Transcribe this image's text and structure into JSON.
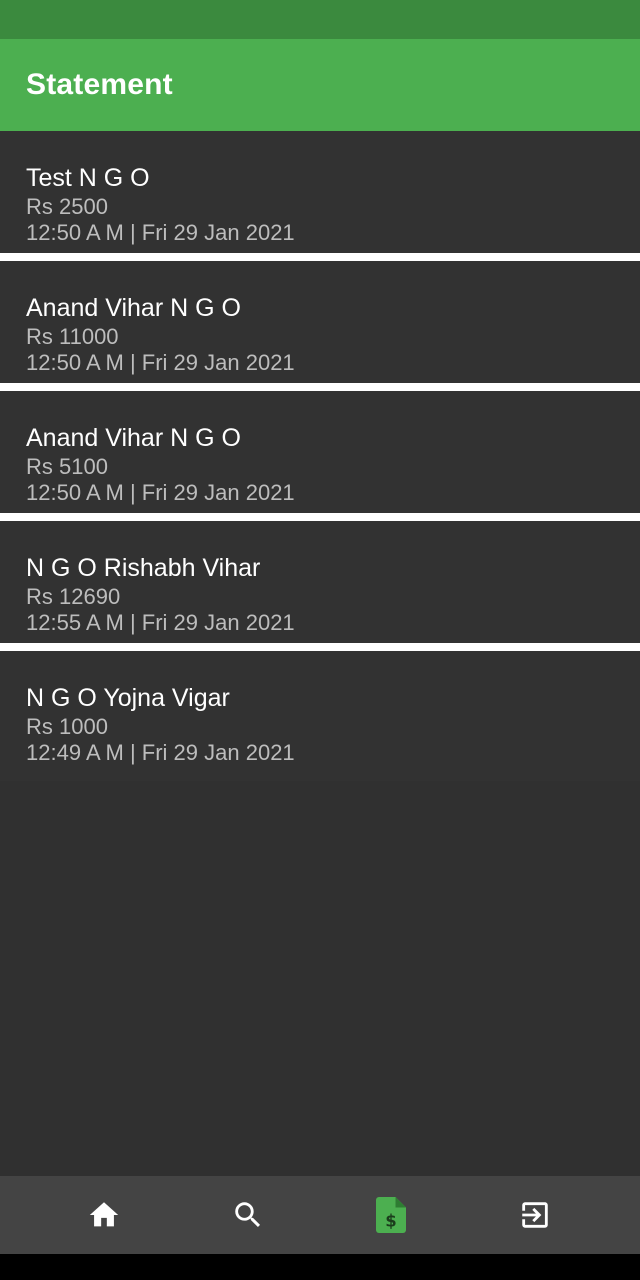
{
  "app_bar": {
    "title": "Statement"
  },
  "statements": [
    {
      "name": "Test N G O",
      "amount": "Rs 2500",
      "time": "12:50 A M | Fri 29 Jan 2021"
    },
    {
      "name": "Anand Vihar N G O",
      "amount": "Rs 11000",
      "time": "12:50 A M | Fri 29 Jan 2021"
    },
    {
      "name": "Anand Vihar N G O",
      "amount": "Rs 5100",
      "time": "12:50 A M | Fri 29 Jan 2021"
    },
    {
      "name": "N G O Rishabh Vihar",
      "amount": "Rs 12690",
      "time": "12:55 A M | Fri 29 Jan 2021"
    },
    {
      "name": "N G O Yojna Vigar",
      "amount": "Rs 1000",
      "time": "12:49 A M | Fri 29 Jan 2021"
    }
  ],
  "bottom_nav": {
    "items": [
      {
        "icon": "home-icon",
        "active": false
      },
      {
        "icon": "search-icon",
        "active": false
      },
      {
        "icon": "statement-document-icon",
        "active": true
      },
      {
        "icon": "logout-icon",
        "active": false
      }
    ]
  },
  "colors": {
    "status_bar": "#3b8a3e",
    "app_bar": "#4caf50",
    "background": "#303030",
    "item_background": "#323232",
    "divider": "#ffffff",
    "nav_background": "#444444",
    "active_icon": "#4caf50",
    "inactive_icon": "#ffffff"
  }
}
